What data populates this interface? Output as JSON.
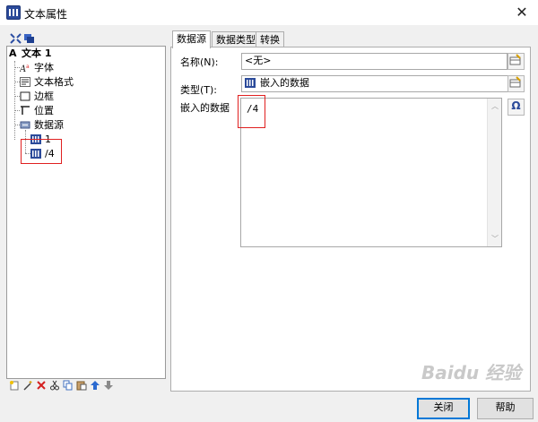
{
  "window": {
    "title": "文本属性",
    "close_glyph": "✕"
  },
  "tree": {
    "items": [
      {
        "label": "文本 1",
        "icon": "text-a-icon"
      },
      {
        "label": "字体",
        "icon": "font-icon"
      },
      {
        "label": "文本格式",
        "icon": "text-format-icon"
      },
      {
        "label": "边框",
        "icon": "border-icon"
      },
      {
        "label": "位置",
        "icon": "position-icon"
      },
      {
        "label": "数据源",
        "icon": "datasource-icon"
      },
      {
        "label": "1",
        "icon": "data-grid-icon"
      },
      {
        "label": "/4",
        "icon": "data-grid-icon"
      }
    ]
  },
  "tabs": [
    "数据源",
    "数据类型",
    "转换"
  ],
  "form": {
    "name_label": "名称(N):",
    "name_value": "<无>",
    "type_label": "类型(T):",
    "type_value": "嵌入的数据",
    "embedded_label": "嵌入的数据",
    "embedded_value": "/4",
    "omega_glyph": "Ω"
  },
  "buttons": {
    "close": "关闭",
    "help": "帮助"
  },
  "watermark": "Baidu 经验",
  "colors": {
    "highlight": "#e02020",
    "accent": "#0078d7"
  }
}
